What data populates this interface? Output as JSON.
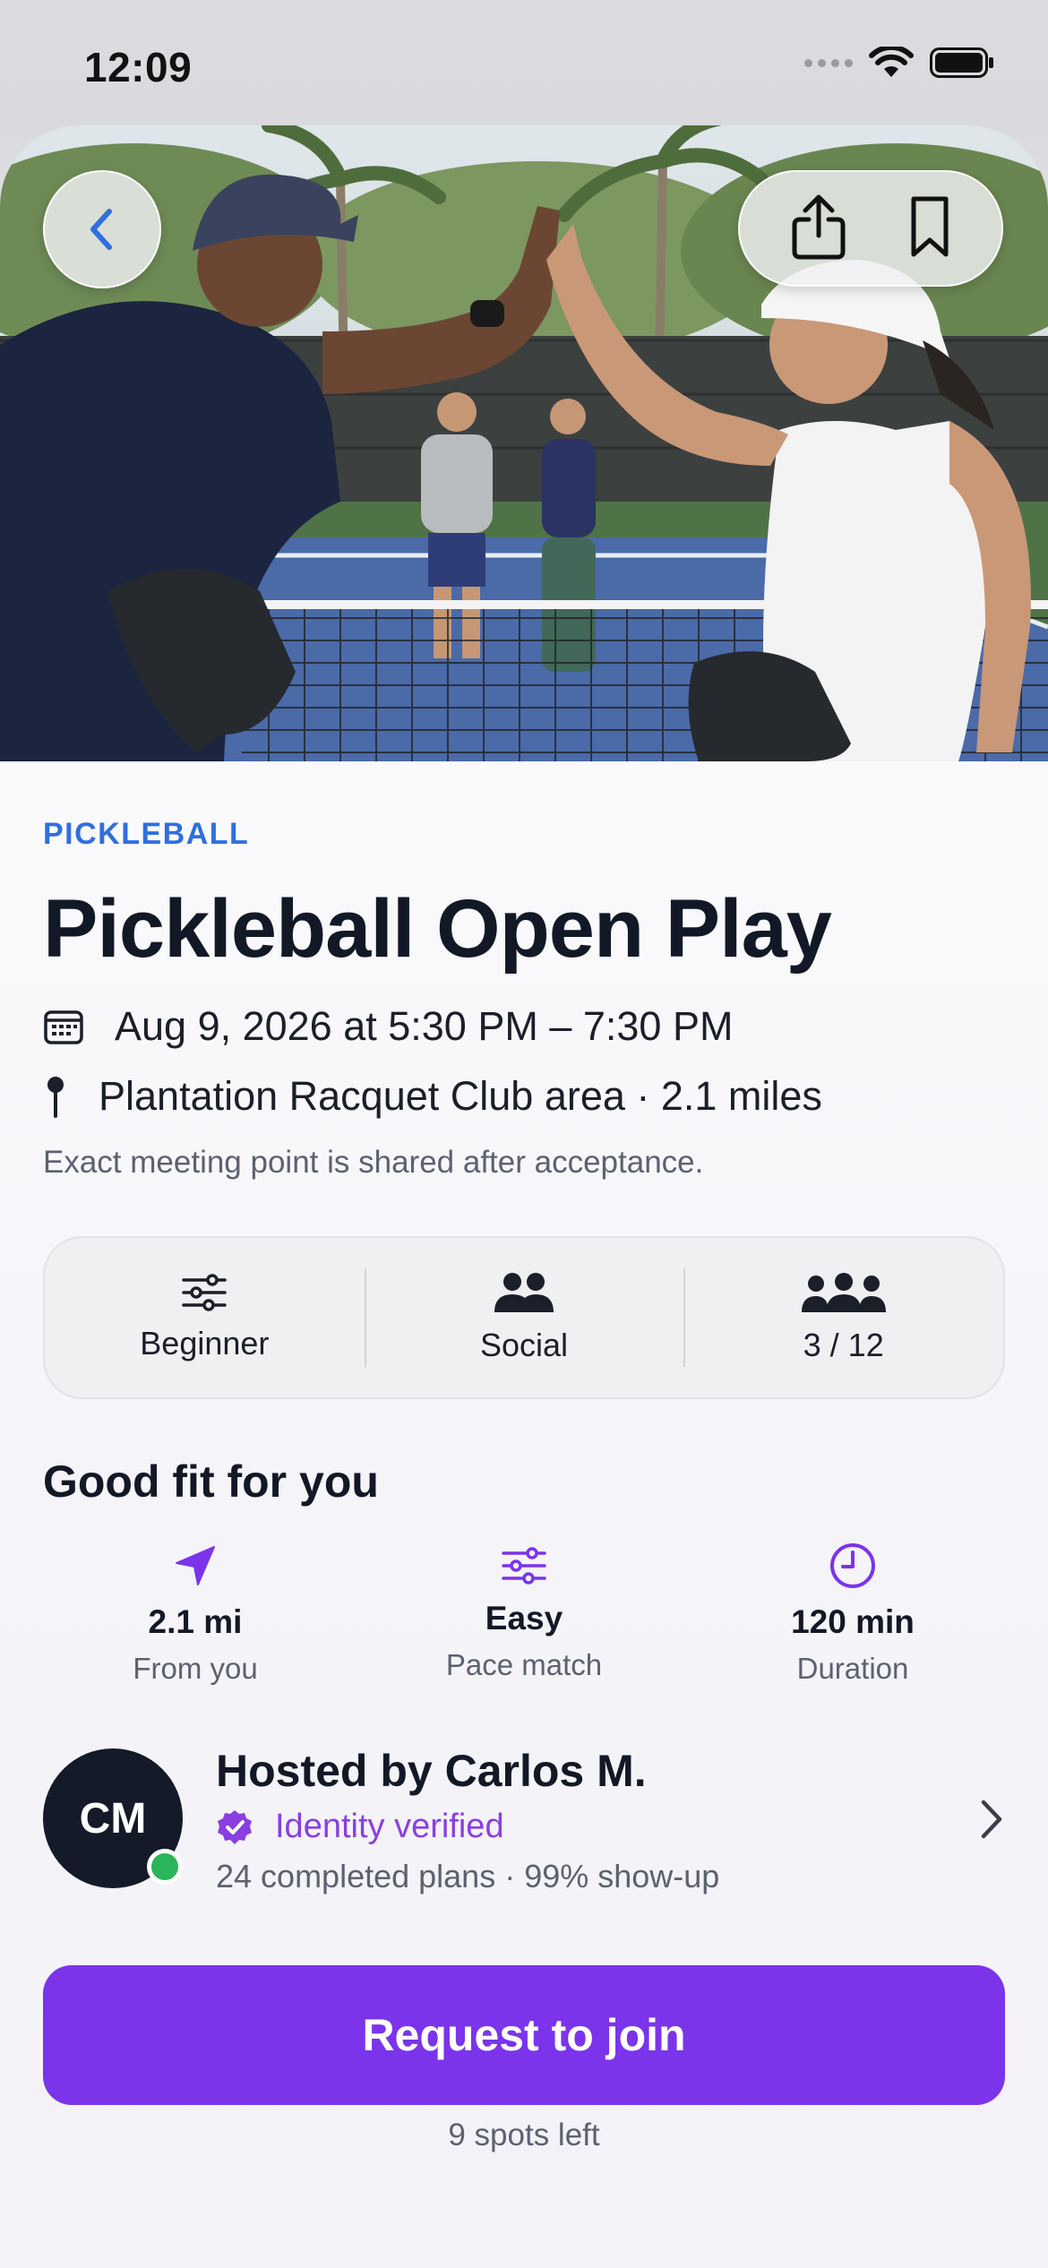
{
  "status_bar": {
    "time": "12:09"
  },
  "hero": {
    "image_alt": "Two pickleball players giving a high five on an outdoor court"
  },
  "event": {
    "category": "PICKLEBALL",
    "title": "Pickleball Open Play",
    "datetime": "Aug 9, 2026 at 5:30 PM – 7:30 PM",
    "location": "Plantation Racquet Club area · 2.1 miles",
    "location_note": "Exact meeting point is shared after acceptance."
  },
  "stats": [
    {
      "label": "Beginner",
      "icon": "sliders-icon"
    },
    {
      "label": "Social",
      "icon": "people-icon"
    },
    {
      "label": "3 / 12",
      "icon": "group-icon"
    }
  ],
  "fit": {
    "title": "Good fit for you",
    "items": [
      {
        "value": "2.1 mi",
        "label": "From you",
        "icon": "location-arrow-icon"
      },
      {
        "value": "Easy",
        "label": "Pace match",
        "icon": "sliders-icon"
      },
      {
        "value": "120 min",
        "label": "Duration",
        "icon": "clock-icon"
      }
    ]
  },
  "host": {
    "initials": "CM",
    "name": "Hosted by Carlos M.",
    "verified": "Identity verified",
    "meta": "24 completed plans · 99% show-up"
  },
  "cta": {
    "label": "Request to join",
    "spots": "9 spots left"
  },
  "colors": {
    "accent": "#7b34ea",
    "category": "#2f6fde",
    "verified": "#8a3fe0",
    "online": "#2ab45b",
    "fit_icon": "#7b34ea"
  }
}
